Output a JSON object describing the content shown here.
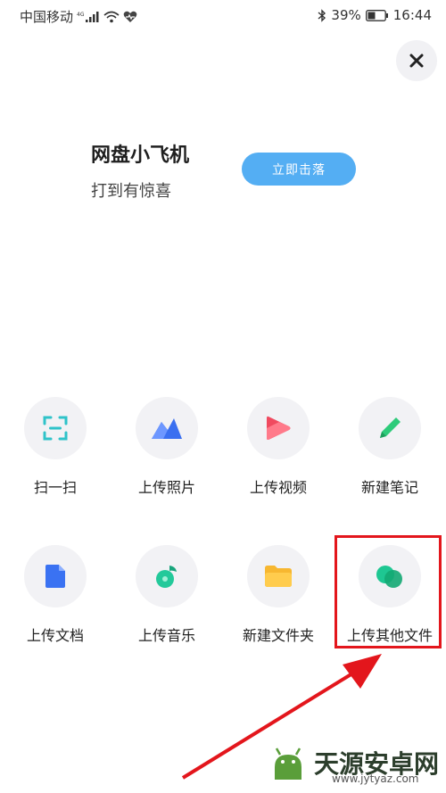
{
  "status_bar": {
    "carrier": "中国移动",
    "network": "4G",
    "battery": "39%",
    "time": "16:44"
  },
  "close": {
    "icon": "close-icon"
  },
  "promo": {
    "title": "网盘小飞机",
    "subtitle": "打到有惊喜",
    "button_label": "立即击落",
    "button_color": "#54aef3"
  },
  "actions": [
    {
      "label": "扫一扫",
      "icon": "scan-icon"
    },
    {
      "label": "上传照片",
      "icon": "photo-icon"
    },
    {
      "label": "上传视频",
      "icon": "video-icon"
    },
    {
      "label": "新建笔记",
      "icon": "note-pen-icon"
    },
    {
      "label": "上传文档",
      "icon": "document-icon"
    },
    {
      "label": "上传音乐",
      "icon": "music-icon"
    },
    {
      "label": "新建文件夹",
      "icon": "folder-icon"
    },
    {
      "label": "上传其他文件",
      "icon": "other-files-icon"
    }
  ],
  "annotation": {
    "highlight_color": "#e3161c"
  },
  "watermark": {
    "text": "天源安卓网",
    "url": "www.jytyaz.com"
  }
}
